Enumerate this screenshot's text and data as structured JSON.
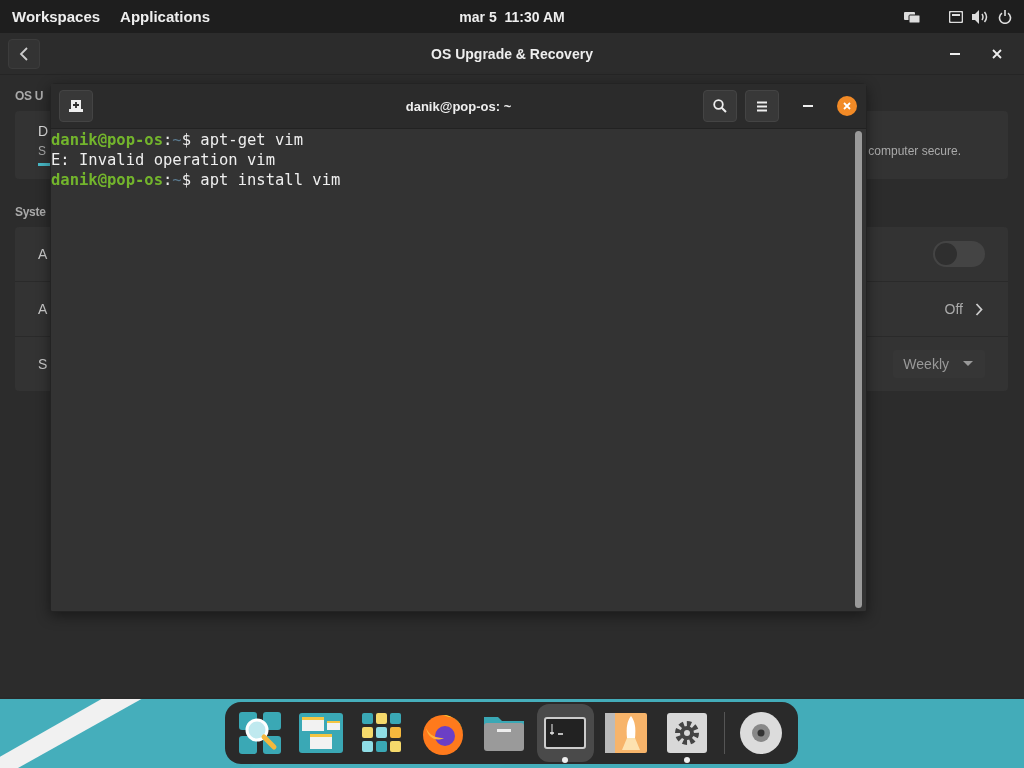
{
  "top_bar": {
    "buttons": [
      "Workspaces",
      "Applications"
    ],
    "clock": "mar 5  11:30 AM"
  },
  "settings_window": {
    "title": "OS Upgrade & Recovery",
    "sections": [
      {
        "title": "OS U",
        "rows": [
          {
            "kind": "text",
            "label": "D",
            "lines": [
              {
                "left": "S",
                "right": "computer secure."
              }
            ]
          }
        ]
      },
      {
        "title": "Syste",
        "rows": [
          {
            "kind": "switch",
            "label": "A",
            "on": false
          },
          {
            "kind": "link",
            "label": "A",
            "value": "Off"
          },
          {
            "kind": "dropdown",
            "label": "S",
            "value": "Weekly"
          }
        ]
      }
    ]
  },
  "terminal": {
    "title": "danik@pop-os: ~",
    "lines": [
      {
        "kind": "prompt",
        "user": "danik@pop-os",
        "sep": ":",
        "path": "~",
        "sigil": "$",
        "command": "apt-get vim"
      },
      {
        "kind": "output",
        "text": "E: Invalid operation vim"
      },
      {
        "kind": "prompt",
        "user": "danik@pop-os",
        "sep": ":",
        "path": "~",
        "sigil": "$",
        "command": "apt install vim"
      }
    ]
  },
  "dock": {
    "items": [
      {
        "kind": "search",
        "running": false,
        "selected": false
      },
      {
        "kind": "workspaces",
        "running": false,
        "selected": false
      },
      {
        "kind": "apps",
        "running": false,
        "selected": false
      },
      {
        "kind": "browser",
        "running": false,
        "selected": false
      },
      {
        "kind": "files",
        "running": false,
        "selected": false
      },
      {
        "kind": "terminal",
        "running": true,
        "selected": true
      },
      {
        "kind": "shop",
        "running": false,
        "selected": false
      },
      {
        "kind": "settings",
        "running": true,
        "selected": false
      },
      {
        "kind": "disc",
        "running": false,
        "selected": false
      }
    ]
  }
}
